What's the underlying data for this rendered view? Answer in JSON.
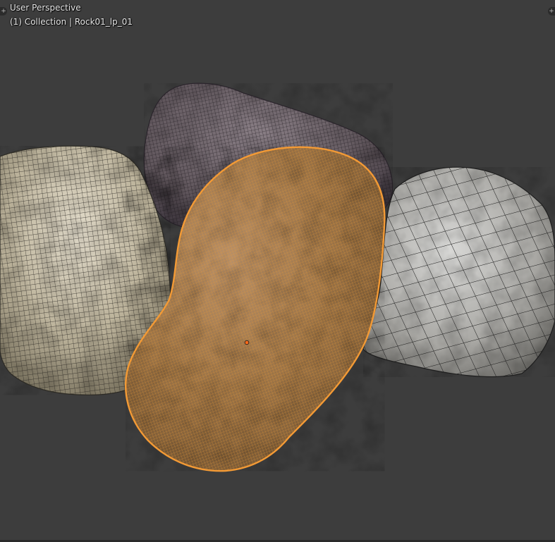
{
  "viewport": {
    "view_name": "User Perspective",
    "object_info": "(1) Collection | Rock01_lp_01",
    "background_color": "#3d3d3d"
  },
  "corner_controls": {
    "left_icon": "plus-icon",
    "right_icon": "plus-icon",
    "glyph": "+"
  },
  "scene": {
    "objects": [
      {
        "name": "rock-left",
        "material": "sandy-cream-rock",
        "wire_color": "#2a2a26"
      },
      {
        "name": "rock-back",
        "material": "dark-purple-rock",
        "wire_color": "#1e1a1f"
      },
      {
        "name": "rock-right",
        "material": "grey-granite-rock",
        "wire_color": "#1c1c1c"
      },
      {
        "name": "rock-selected",
        "material": "sandy-rock",
        "wire_color": "#e08a2c",
        "selected": true,
        "origin_color": "#ff6a1a"
      }
    ],
    "selection_outline_color": "#f39a35"
  }
}
